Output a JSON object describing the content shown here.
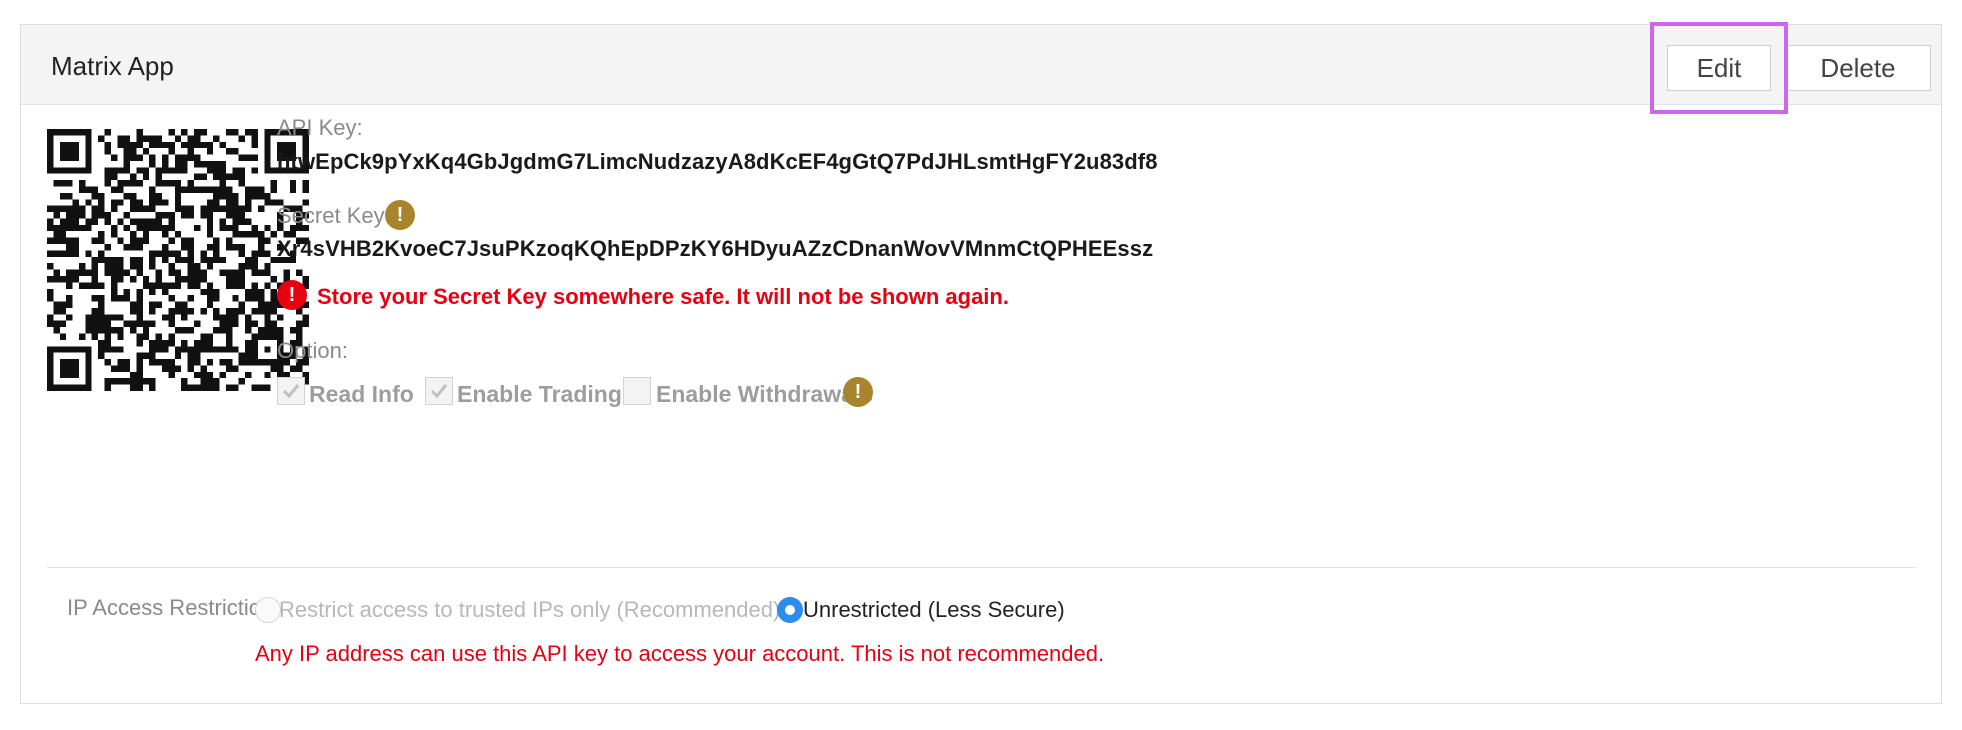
{
  "header": {
    "app_name": "Matrix App",
    "edit_label": "Edit",
    "delete_label": "Delete",
    "highlight_color": "#cc66ee"
  },
  "api_key": {
    "label": "API Key:",
    "value": "htwEpCk9pYxKq4GbJgdmG7LimcNudzazyA8dKcEF4gGtQ7PdJHLsmtHgFY2u83df8"
  },
  "secret_key": {
    "label": "Secret Key:",
    "value": "Xr4sVHB2KvoeC7JsuPKzoqKQhEpDPzKY6HDyuAZzCDnanWovVMnmCtQPHEEssz",
    "warning_icon": "exclamation-icon"
  },
  "store_warning": {
    "icon": "error-icon",
    "text": "Store your Secret Key somewhere safe. It will not be shown again."
  },
  "options": {
    "label": "Option:",
    "items": [
      {
        "label": "Read Info",
        "checked": true
      },
      {
        "label": "Enable Trading",
        "checked": true
      },
      {
        "label": "Enable Withdrawals",
        "checked": false
      }
    ]
  },
  "ip_restriction": {
    "label": "IP Access Restriction:",
    "options": [
      {
        "label": "Restrict access to trusted IPs only (Recommended)",
        "selected": false
      },
      {
        "label": "Unrestricted (Less Secure)",
        "selected": true
      }
    ],
    "warning": "Any IP address can use this API key to access your account. This is not recommended."
  },
  "colors": {
    "error_red": "#e60012",
    "warning_gold": "#a8852c",
    "radio_blue": "#2d8cf0"
  }
}
